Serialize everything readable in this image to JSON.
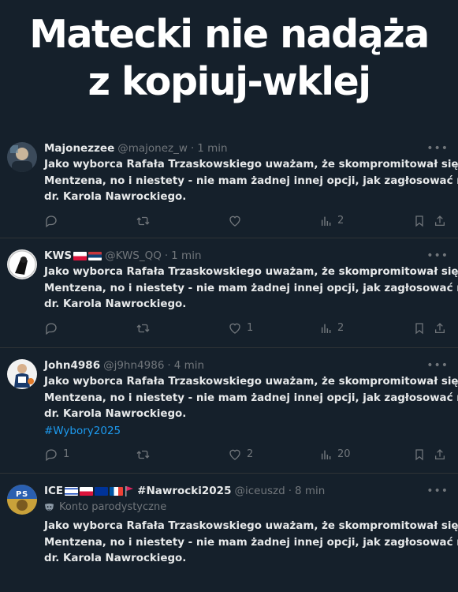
{
  "headline": {
    "line1": "Matecki nie nadąża",
    "line2": "z kopiuj-wklej"
  },
  "tweets": [
    {
      "name": "Majonezzee",
      "handle": "@majonez_w",
      "separator": "·",
      "time": "1 min",
      "text_lines": [
        "Jako wyborca Rafała Trzaskowskiego uważam, że skompromitował się u",
        "Mentzena, no i niestety - nie mam żadnej innej opcji, jak zagłosować na",
        "dr. Karola Nawrockiego."
      ],
      "replies": "",
      "retweets": "",
      "likes": "",
      "views": "2"
    },
    {
      "name": "KWS",
      "flags": [
        "poland",
        "serbia"
      ],
      "handle": "@KWS_QQ",
      "separator": "·",
      "time": "1 min",
      "text_lines": [
        "Jako wyborca Rafała Trzaskowskiego uważam, że skompromitował się u",
        "Mentzena, no i niestety - nie mam żadnej innej opcji, jak zagłosować na",
        "dr. Karola Nawrockiego."
      ],
      "replies": "",
      "retweets": "",
      "likes": "1",
      "views": "2"
    },
    {
      "name": "John4986",
      "handle": "@j9hn4986",
      "separator": "·",
      "time": "4 min",
      "text_lines": [
        "Jako wyborca Rafała Trzaskowskiego uważam, że skompromitował się u",
        "Mentzena, no i niestety - nie mam żadnej innej opcji, jak zagłosować na",
        "dr. Karola Nawrockiego."
      ],
      "hashtag": "#Wybory2025",
      "replies": "1",
      "retweets": "",
      "likes": "2",
      "views": "20"
    },
    {
      "name": "ICE",
      "flags": [
        "israel",
        "poland",
        "eu",
        "france",
        "red-pennant"
      ],
      "name_suffix": "#Nawrocki2025",
      "handle": "@iceuszd",
      "separator": "·",
      "time": "8 min",
      "parody_label": "Konto parodystyczne",
      "text_lines": [
        "Jako wyborca Rafała Trzaskowskiego uważam, że skompromitował się u",
        "Mentzena, no i niestety - nie mam żadnej innej opcji, jak zagłosować na",
        "dr. Karola Nawrockiego."
      ]
    }
  ],
  "icons": {
    "more": "more-dots-icon",
    "reply": "reply-icon",
    "retweet": "retweet-icon",
    "like": "heart-icon",
    "views": "views-chart-icon",
    "bookmark": "bookmark-icon",
    "share": "share-icon"
  },
  "colors": {
    "background": "#15202b",
    "text": "#e7e9ea",
    "muted": "#71767b",
    "link": "#1d9bf0",
    "divider": "#2f3336"
  }
}
